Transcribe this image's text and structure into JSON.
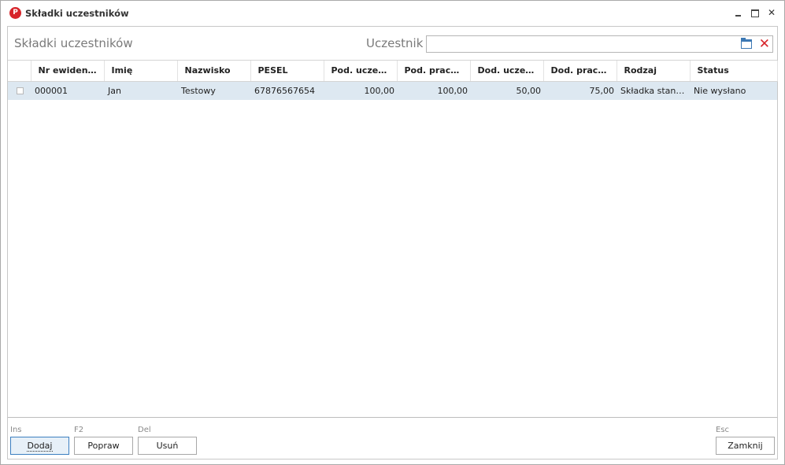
{
  "window": {
    "title": "Składki uczestników",
    "logo_letter": "P"
  },
  "form": {
    "title": "Składki uczestników",
    "filter_label": "Uczestnik",
    "filter_value": ""
  },
  "table": {
    "columns": [
      "",
      "Nr ewidencyj...",
      "Imię",
      "Nazwisko",
      "PESEL",
      "Pod. uczestni...",
      "Pod. pracoda...",
      "Dod. uczestni...",
      "Dod. pracoda...",
      "Rodzaj",
      "Status"
    ],
    "rows": [
      {
        "nr": "000001",
        "imie": "Jan",
        "nazwisko": "Testowy",
        "pesel": "67876567654",
        "pod_uczestnik": "100,00",
        "pod_pracodawca": "100,00",
        "dod_uczestnik": "50,00",
        "dod_pracodawca": "75,00",
        "rodzaj": "Składka stand...",
        "status": "Nie wysłano"
      }
    ]
  },
  "footer": {
    "add": {
      "hotkey": "Ins",
      "label": "Dodaj"
    },
    "edit": {
      "hotkey": "F2",
      "label": "Popraw"
    },
    "delete": {
      "hotkey": "Del",
      "label": "Usuń"
    },
    "close": {
      "hotkey": "Esc",
      "label": "Zamknij"
    }
  },
  "icons": {
    "logo": "app-logo-icon",
    "minimize": "minimize-icon",
    "maximize": "maximize-icon",
    "close": "close-icon",
    "browse": "folder-icon",
    "clear": "clear-x-icon"
  },
  "colors": {
    "accent": "#d7252b",
    "selection": "#dde8f1",
    "primary_button_border": "#3c7fc0"
  }
}
